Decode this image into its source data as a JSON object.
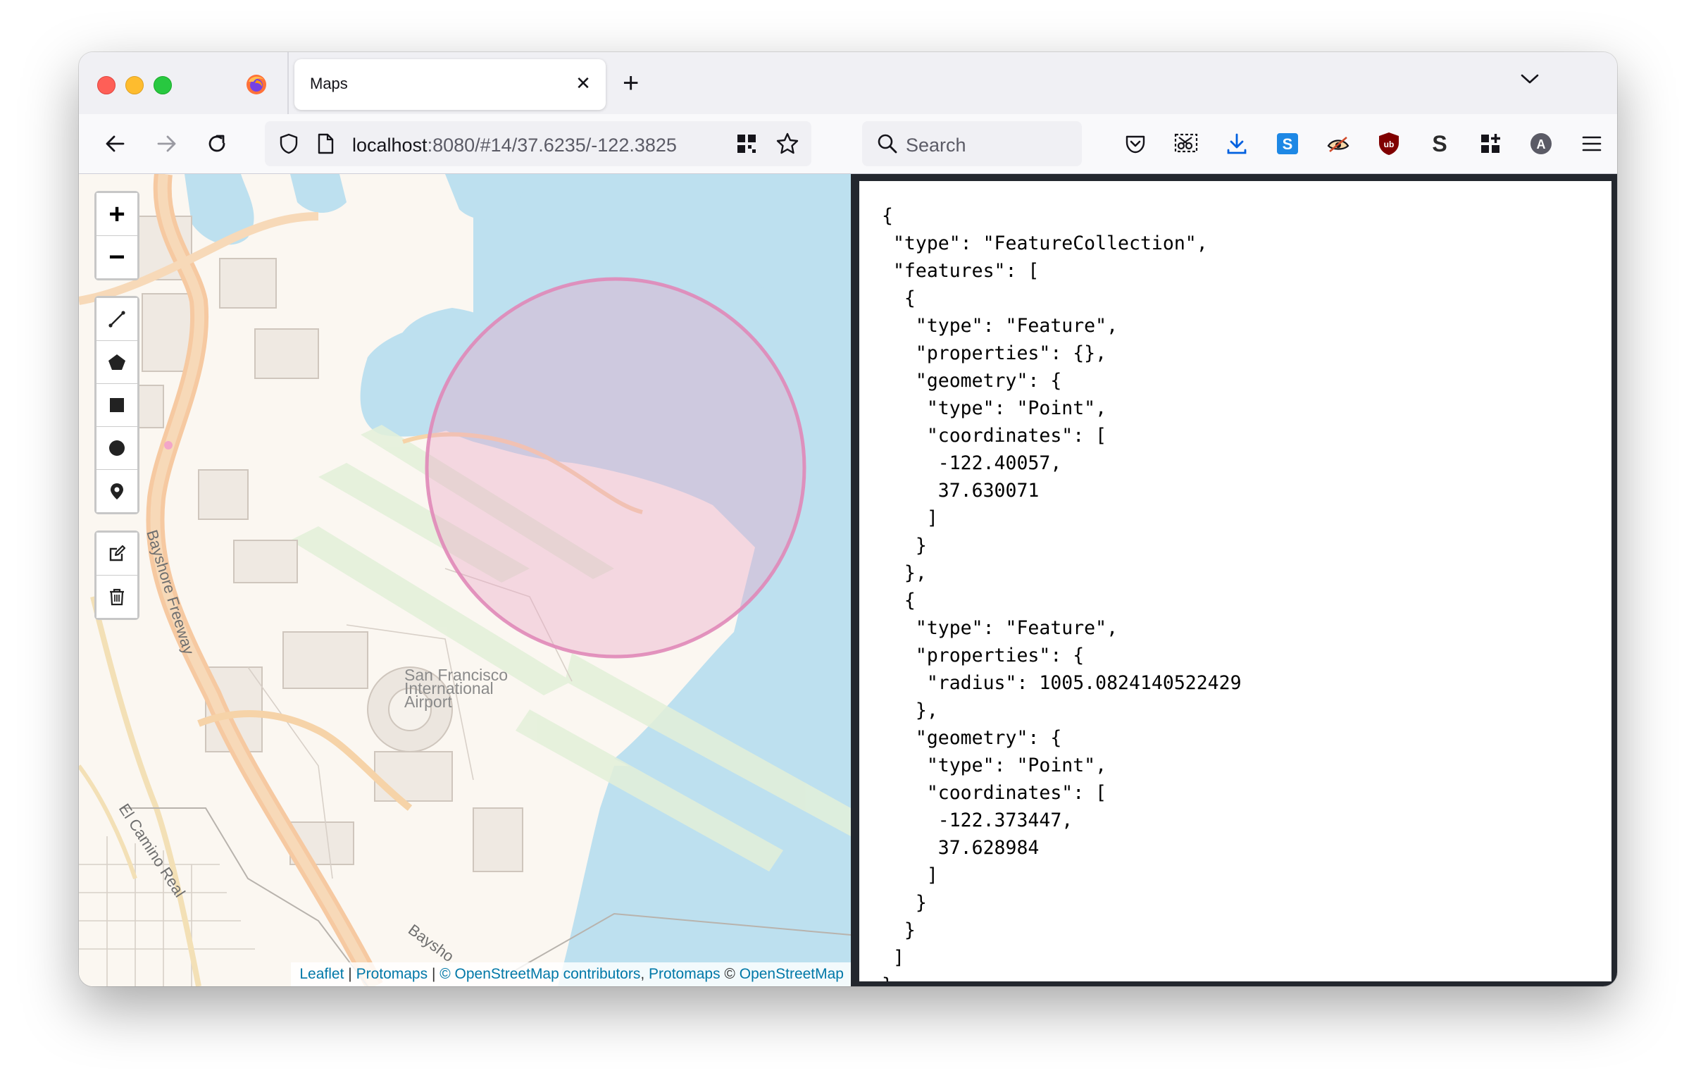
{
  "browser": {
    "tab_title": "Maps",
    "tab_close": "✕",
    "new_tab": "+",
    "url_host": "localhost",
    "url_rest": ":8080/#14/37.6235/-122.3825",
    "search_placeholder": "Search"
  },
  "map": {
    "labels": {
      "airport_line1": "San Francisco",
      "airport_line2": "International",
      "airport_line3": "Airport",
      "bayshore1": "Bayshore Freeway",
      "bayshore2": "Baysho",
      "el_camino": "El Camino Real"
    },
    "controls": {
      "zoom_in": "+",
      "zoom_out": "−"
    },
    "attribution": {
      "leaflet": "Leaflet",
      "sep1": " | ",
      "protomaps1": "Protomaps",
      "sep2": " | ",
      "osm_contrib": "© OpenStreetMap contributors",
      "sep3": ", ",
      "protomaps2": "Protomaps",
      "copy": " © ",
      "osm": "OpenStreetMap"
    },
    "colors": {
      "water": "#bde0ef",
      "land": "#fbf7f1",
      "circle_stroke": "#e088b8",
      "circle_fill": "#e9a2c6"
    }
  },
  "geojson_text": "{\n \"type\": \"FeatureCollection\",\n \"features\": [\n  {\n   \"type\": \"Feature\",\n   \"properties\": {},\n   \"geometry\": {\n    \"type\": \"Point\",\n    \"coordinates\": [\n     -122.40057,\n     37.630071\n    ]\n   }\n  },\n  {\n   \"type\": \"Feature\",\n   \"properties\": {\n    \"radius\": 1005.0824140522429\n   },\n   \"geometry\": {\n    \"type\": \"Point\",\n    \"coordinates\": [\n     -122.373447,\n     37.628984\n    ]\n   }\n  }\n ]\n}"
}
